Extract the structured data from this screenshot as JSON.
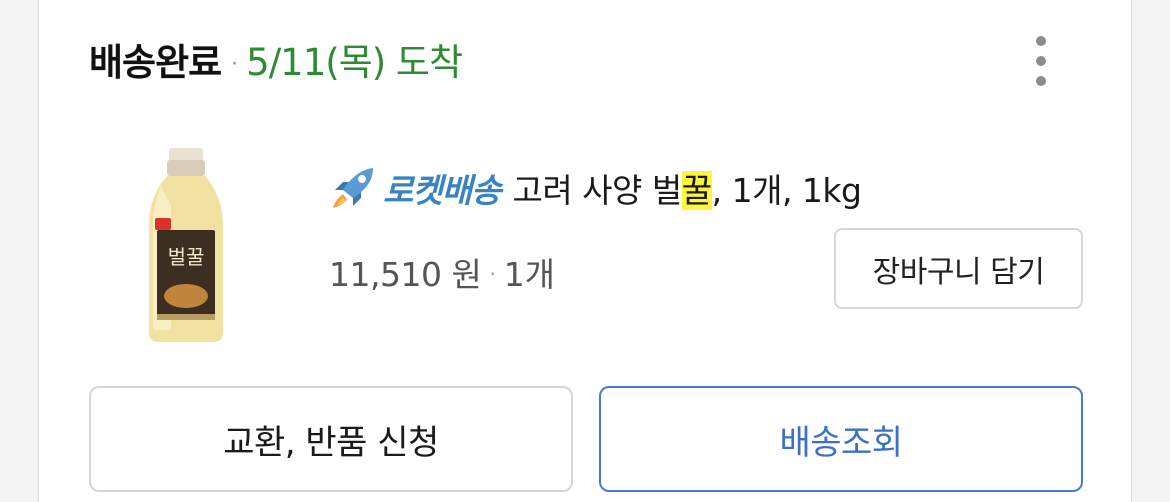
{
  "order": {
    "status": "배송완료",
    "separator": "·",
    "arrival": "5/11(목) 도착"
  },
  "product": {
    "delivery_badge": "로켓배송",
    "name_before": "고려 사양 벌",
    "name_highlight": "꿀",
    "name_after": ", 1개, 1kg",
    "price": "11,510 원",
    "price_separator": "·",
    "quantity": "1개",
    "thumbnail_label": "벌꿀"
  },
  "actions": {
    "add_to_cart": "장바구니 담기",
    "return_request": "교환, 반품 신청",
    "track_delivery": "배송조회"
  },
  "colors": {
    "arrival_green": "#2f8a34",
    "rocket_blue": "#3a82c4",
    "highlight_yellow": "#fff53a",
    "track_button_blue": "#3c6fc6"
  },
  "icons": {
    "more": "more-vertical-icon",
    "rocket": "rocket-icon"
  }
}
